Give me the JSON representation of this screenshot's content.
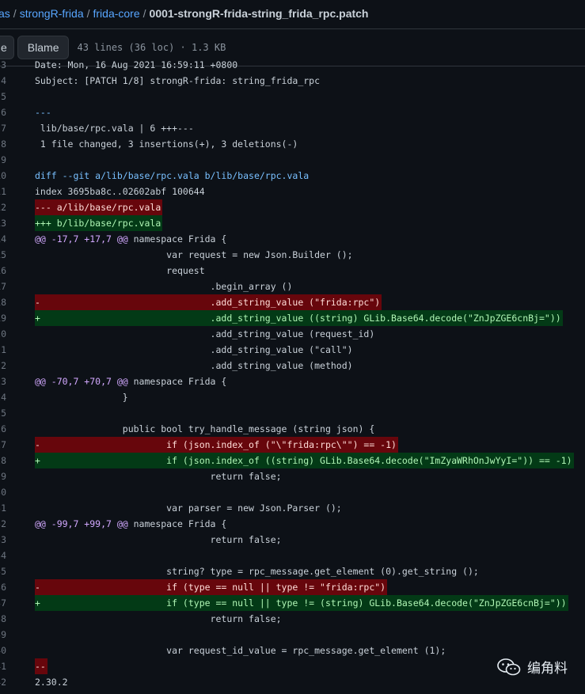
{
  "breadcrumb": {
    "items": [
      "as",
      "strongR-frida",
      "frida-core"
    ],
    "separator": "/",
    "current": "0001-strongR-frida-string_frida_rpc.patch"
  },
  "toolbar": {
    "raw_label": "e",
    "blame_label": "Blame",
    "stats": "43 lines (36 loc) · 1.3 KB"
  },
  "code": {
    "lines": [
      {
        "n": "3",
        "type": "plain",
        "text": "Date: Mon, 16 Aug 2021 16:59:11 +0800"
      },
      {
        "n": "4",
        "type": "plain",
        "text": "Subject: [PATCH 1/8] strongR-frida: string_frida_rpc"
      },
      {
        "n": "5",
        "type": "plain",
        "text": ""
      },
      {
        "n": "6",
        "type": "sep",
        "text": "---"
      },
      {
        "n": "7",
        "type": "plain",
        "text": " lib/base/rpc.vala | 6 +++---"
      },
      {
        "n": "8",
        "type": "plain",
        "text": " 1 file changed, 3 insertions(+), 3 deletions(-)"
      },
      {
        "n": "9",
        "type": "plain",
        "text": ""
      },
      {
        "n": "10",
        "type": "diffhdr",
        "text": "diff --git a/lib/base/rpc.vala b/lib/base/rpc.vala"
      },
      {
        "n": "11",
        "type": "plain",
        "text": "index 3695ba8c..02602abf 100644"
      },
      {
        "n": "12",
        "type": "del",
        "text": "--- a/lib/base/rpc.vala"
      },
      {
        "n": "13",
        "type": "add",
        "text": "+++ b/lib/base/rpc.vala"
      },
      {
        "n": "14",
        "type": "hunk",
        "text": "@@ -17,7 +17,7 @@",
        "rest": " namespace Frida {"
      },
      {
        "n": "15",
        "type": "plain",
        "text": "                        var request = new Json.Builder ();"
      },
      {
        "n": "16",
        "type": "plain",
        "text": "                        request"
      },
      {
        "n": "17",
        "type": "plain",
        "text": "                                .begin_array ()"
      },
      {
        "n": "18",
        "type": "del",
        "text": "-                               .add_string_value (\"frida:rpc\")"
      },
      {
        "n": "19",
        "type": "add",
        "text": "+                               .add_string_value ((string) GLib.Base64.decode(\"ZnJpZGE6cnBj=\"))"
      },
      {
        "n": "20",
        "type": "plain",
        "text": "                                .add_string_value (request_id)"
      },
      {
        "n": "21",
        "type": "plain",
        "text": "                                .add_string_value (\"call\")"
      },
      {
        "n": "22",
        "type": "plain",
        "text": "                                .add_string_value (method)"
      },
      {
        "n": "23",
        "type": "hunk",
        "text": "@@ -70,7 +70,7 @@",
        "rest": " namespace Frida {"
      },
      {
        "n": "24",
        "type": "plain",
        "text": "                }"
      },
      {
        "n": "25",
        "type": "plain",
        "text": ""
      },
      {
        "n": "26",
        "type": "plain",
        "text": "                public bool try_handle_message (string json) {"
      },
      {
        "n": "27",
        "type": "del",
        "text": "-                       if (json.index_of (\"\\\"frida:rpc\\\"\") == -1)"
      },
      {
        "n": "28",
        "type": "add",
        "text": "+                       if (json.index_of ((string) GLib.Base64.decode(\"ImZyaWRhOnJwYyI=\")) == -1)"
      },
      {
        "n": "29",
        "type": "plain",
        "text": "                                return false;"
      },
      {
        "n": "30",
        "type": "plain",
        "text": ""
      },
      {
        "n": "31",
        "type": "plain",
        "text": "                        var parser = new Json.Parser ();"
      },
      {
        "n": "32",
        "type": "hunk",
        "text": "@@ -99,7 +99,7 @@",
        "rest": " namespace Frida {"
      },
      {
        "n": "33",
        "type": "plain",
        "text": "                                return false;"
      },
      {
        "n": "34",
        "type": "plain",
        "text": ""
      },
      {
        "n": "35",
        "type": "plain",
        "text": "                        string? type = rpc_message.get_element (0).get_string ();"
      },
      {
        "n": "36",
        "type": "del",
        "text": "-                       if (type == null || type != \"frida:rpc\")"
      },
      {
        "n": "37",
        "type": "add",
        "text": "+                       if (type == null || type != (string) GLib.Base64.decode(\"ZnJpZGE6cnBj=\"))"
      },
      {
        "n": "38",
        "type": "plain",
        "text": "                                return false;"
      },
      {
        "n": "39",
        "type": "plain",
        "text": ""
      },
      {
        "n": "40",
        "type": "plain",
        "text": "                        var request_id_value = rpc_message.get_element (1);"
      },
      {
        "n": "41",
        "type": "del",
        "text": "--"
      },
      {
        "n": "42",
        "type": "plain",
        "text": "2.30.2"
      }
    ]
  },
  "watermark": {
    "text": "编角料",
    "icon": "wechat-icon"
  }
}
